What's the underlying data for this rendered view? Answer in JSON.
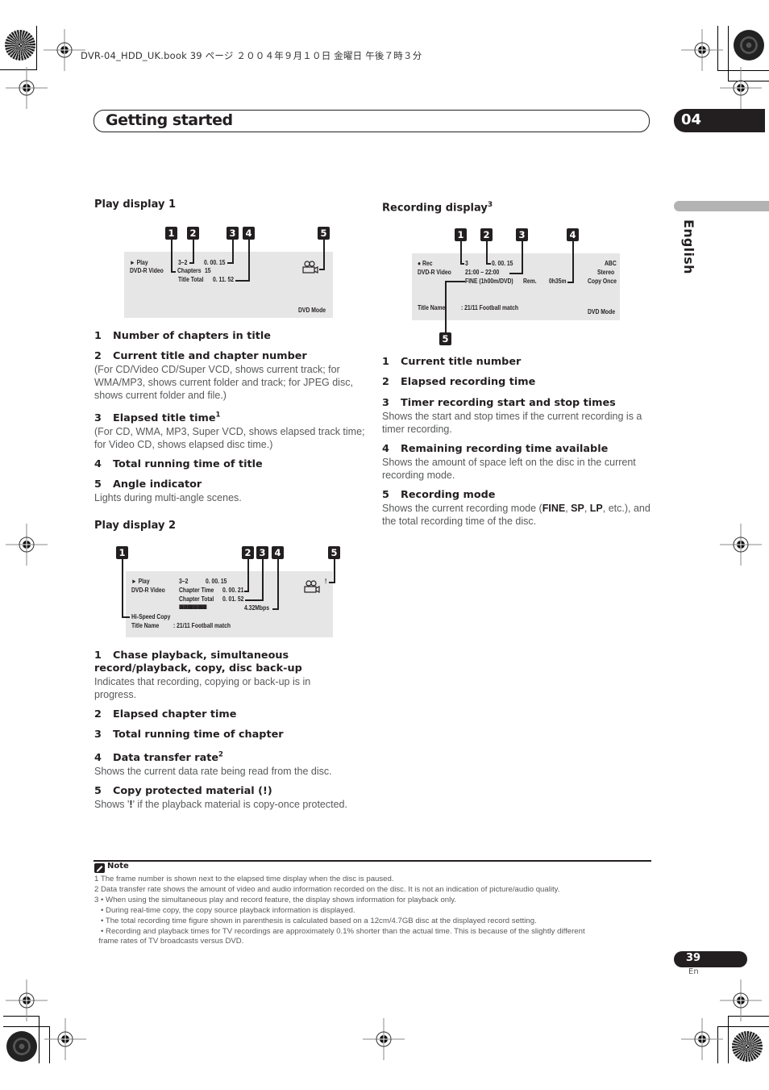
{
  "print_header": "DVR-04_HDD_UK.book  39 ページ  ２００４年９月１０日  金曜日  午後７時３分",
  "chapter": {
    "title": "Getting started",
    "number": "04"
  },
  "side_tab": {
    "language": "English"
  },
  "play_display_1": {
    "heading": "Play display 1",
    "badges": [
      "1",
      "2",
      "3",
      "4",
      "5"
    ],
    "screen": {
      "mode_line": "► Play",
      "disc_type": "DVD-R   Video",
      "title_chapter": "3–2",
      "elapsed": "0. 00. 15",
      "chapters_label": "Chapters",
      "chapters_value": "15",
      "title_total_label": "Title Total",
      "title_total_value": "0. 11. 52",
      "footer": "DVD Mode"
    },
    "items": [
      {
        "num": "1",
        "title": "Number of chapters in title",
        "sup": "",
        "body": ""
      },
      {
        "num": "2",
        "title": "Current title and chapter number",
        "sup": "",
        "body": "(For CD/Video CD/Super VCD, shows current track; for WMA/MP3, shows current folder and track; for JPEG disc, shows current folder and file.)"
      },
      {
        "num": "3",
        "title": "Elapsed title time",
        "sup": "1",
        "body": "(For CD, WMA, MP3, Super VCD, shows elapsed track time; for Video CD, shows elapsed disc time.)"
      },
      {
        "num": "4",
        "title": "Total running time of title",
        "sup": "",
        "body": ""
      },
      {
        "num": "5",
        "title": "Angle indicator",
        "sup": "",
        "body": "Lights during multi-angle scenes."
      }
    ]
  },
  "play_display_2": {
    "heading": "Play display 2",
    "badges": [
      "1",
      "2",
      "3",
      "4",
      "5"
    ],
    "screen": {
      "mode_line": "► Play",
      "disc_type": "DVD-R   Video",
      "title_chapter": "3–2",
      "elapsed": "0. 00. 15",
      "chapter_time_label": "Chapter Time",
      "chapter_time_value": "0. 00. 21",
      "chapter_total_label": "Chapter Total",
      "chapter_total_value": "0. 01. 52",
      "rate_bar": "▮▮▮▮▮▮▮▮▮▮▮▮▮▮",
      "rate": "4.32Mbps",
      "copy_status": "Hi-Speed Copy",
      "title_name_label": "Title Name",
      "title_name_value": ":  21/11 Football match",
      "protect_mark": "!"
    },
    "items": [
      {
        "num": "1",
        "title": "Chase playback, simultaneous record/playback, copy, disc back-up",
        "sup": "",
        "body": "Indicates that recording, copying or back-up is in progress."
      },
      {
        "num": "2",
        "title": "Elapsed chapter time",
        "sup": "",
        "body": ""
      },
      {
        "num": "3",
        "title": "Total running time of chapter",
        "sup": "",
        "body": ""
      },
      {
        "num": "4",
        "title": "Data transfer rate",
        "sup": "2",
        "body": "Shows the current data rate being read from the disc."
      },
      {
        "num": "5",
        "title": "Copy protected material (!)",
        "sup": "",
        "body_pre": "Shows '",
        "body_bold": "!",
        "body_post": "' if the playback material is copy-once protected."
      }
    ]
  },
  "recording_display": {
    "heading": "Recording display",
    "heading_sup": "3",
    "badges": [
      "1",
      "2",
      "3",
      "4",
      "5"
    ],
    "screen": {
      "mode_line": "● Rec",
      "disc_type": "DVD-R  Video",
      "title_number": "3",
      "elapsed": "0. 00. 15",
      "timer": "21:00  –  22:00",
      "rec_mode": "FINE (1h00m/DVD)",
      "rem_label": "Rem.",
      "rem_value": "0h35m",
      "channel": "ABC",
      "audio": "Stereo",
      "copy": "Copy Once",
      "title_name_label": "Title Name",
      "title_name_value": ":  21/11 Football match",
      "footer": "DVD Mode"
    },
    "items": [
      {
        "num": "1",
        "title": "Current title number",
        "body": ""
      },
      {
        "num": "2",
        "title": "Elapsed recording time",
        "body": ""
      },
      {
        "num": "3",
        "title": "Timer recording start and stop times",
        "body": "Shows the start and stop times if the current recording is a timer recording."
      },
      {
        "num": "4",
        "title": "Remaining recording time available",
        "body": "Shows the amount of space left on the disc in the current recording mode."
      },
      {
        "num": "5",
        "title": "Recording mode",
        "body_pre": "Shows the current recording mode (",
        "modes": [
          "FINE",
          "SP",
          "LP"
        ],
        "body_post": ", etc.), and the total recording time of the disc."
      }
    ]
  },
  "notes": {
    "title": "Note",
    "lines": [
      "1 The frame number is shown next to the elapsed time display when the disc is paused.",
      "2 Data transfer rate shows the amount of video and audio information recorded on the disc. It is not an indication of picture/audio quality.",
      "3 • When using the simultaneous play and record feature, the display shows information for playback only.",
      "   • During real-time copy, the copy source playback information is displayed.",
      "   • The total recording time figure shown in parenthesis is calculated based on a 12cm/4.7GB disc at the displayed record setting.",
      "   • Recording and playback times for TV recordings are approximately 0.1% shorter than the actual time. This is because of the slightly different",
      "  frame rates of TV broadcasts versus DVD."
    ]
  },
  "footer": {
    "page_number": "39",
    "language_code": "En"
  }
}
